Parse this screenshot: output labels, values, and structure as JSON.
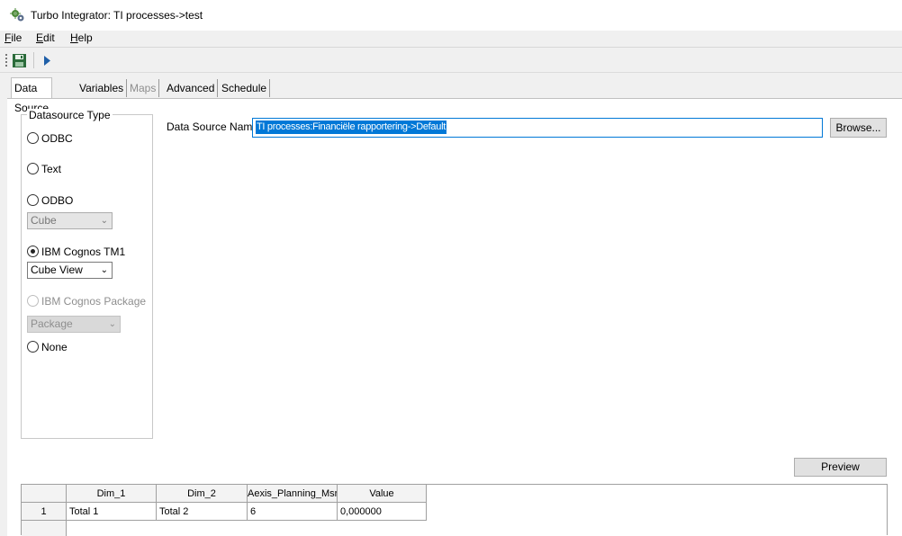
{
  "window": {
    "title": "Turbo Integrator:  TI processes->test",
    "icon": "gears-icon"
  },
  "menu": {
    "file": {
      "first": "F",
      "rest": "ile"
    },
    "edit": {
      "first": "E",
      "rest": "dit"
    },
    "help": {
      "first": "H",
      "rest": "elp"
    }
  },
  "toolbar": {
    "save_icon": "save-icon",
    "run_icon": "run-icon"
  },
  "tabs": [
    {
      "label": "Data Source",
      "state": "active"
    },
    {
      "label": "Variables",
      "state": "normal"
    },
    {
      "label": "Maps",
      "state": "disabled"
    },
    {
      "label": "Advanced",
      "state": "normal"
    },
    {
      "label": "Schedule",
      "state": "normal"
    }
  ],
  "datasource_type": {
    "legend": "Datasource Type",
    "odbc": "ODBC",
    "text": "Text",
    "odbo": "ODBO",
    "odbo_combo": "Cube",
    "tm1": "IBM Cognos TM1",
    "tm1_combo": "Cube View",
    "package": "IBM Cognos Package",
    "package_combo": "Package",
    "none": "None",
    "selected": "IBM Cognos TM1"
  },
  "data_source_name": {
    "label": "Data Source Name:",
    "value": "TI processes:Financiële rapportering->Default"
  },
  "buttons": {
    "browse": "Browse...",
    "preview": "Preview"
  },
  "grid": {
    "columns": [
      "Dim_1",
      "Dim_2",
      "Aexis_Planning_Msr",
      "Value"
    ],
    "rows": [
      {
        "num": "1",
        "cells": [
          "Total 1",
          "Total 2",
          "6",
          "0,000000"
        ]
      }
    ]
  },
  "colors": {
    "selection": "#0078d7",
    "window_bg": "#f0f0f0"
  }
}
